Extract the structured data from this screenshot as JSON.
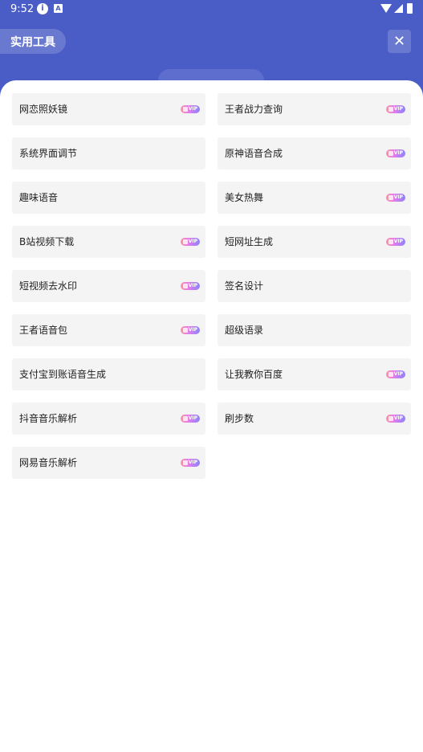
{
  "status_bar": {
    "time": "9:52",
    "info_icon": "info-icon",
    "a_icon": "a-notification-icon",
    "wifi_icon": "wifi-icon",
    "signal_icon": "signal-icon",
    "battery_icon": "battery-icon"
  },
  "header": {
    "title": "实用工具",
    "close_icon": "close-icon",
    "accent_color": "#4a5cc6"
  },
  "vip_badge_text": "VIP",
  "tools": [
    {
      "label": "网恋照妖镜",
      "vip": true
    },
    {
      "label": "王者战力查询",
      "vip": true
    },
    {
      "label": "系统界面调节",
      "vip": false
    },
    {
      "label": "原神语音合成",
      "vip": true
    },
    {
      "label": "趣味语音",
      "vip": false
    },
    {
      "label": "美女热舞",
      "vip": true
    },
    {
      "label": "B站视频下载",
      "vip": true
    },
    {
      "label": "短网址生成",
      "vip": true
    },
    {
      "label": "短视频去水印",
      "vip": true
    },
    {
      "label": "签名设计",
      "vip": false
    },
    {
      "label": "王者语音包",
      "vip": true
    },
    {
      "label": "超级语录",
      "vip": false
    },
    {
      "label": "支付宝到账语音生成",
      "vip": false
    },
    {
      "label": "让我教你百度",
      "vip": true
    },
    {
      "label": "抖音音乐解析",
      "vip": true
    },
    {
      "label": "刷步数",
      "vip": true
    },
    {
      "label": "网易音乐解析",
      "vip": true
    }
  ]
}
